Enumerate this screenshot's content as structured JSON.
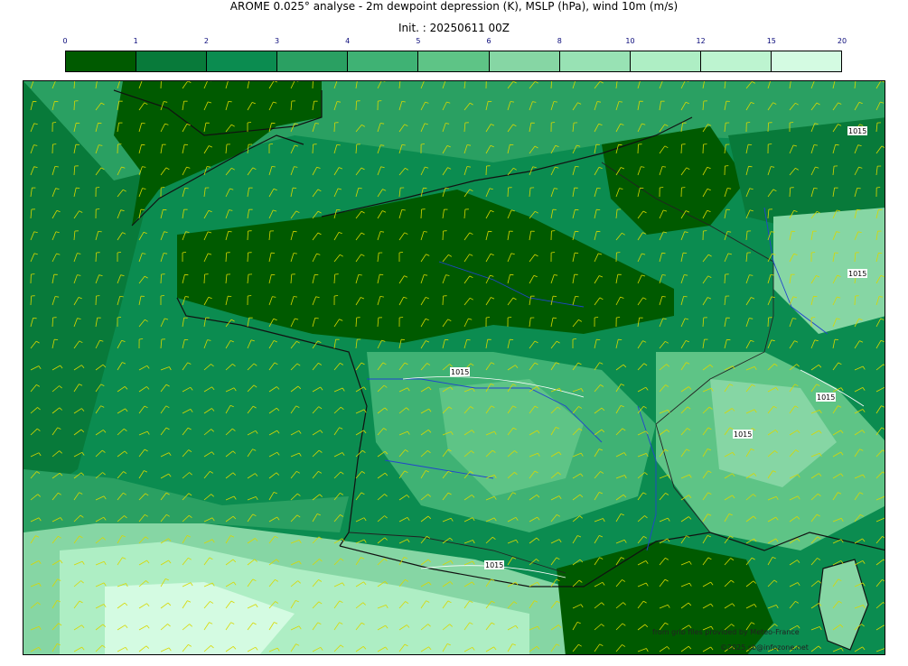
{
  "title": "AROME 0.025° analyse - 2m dewpoint depression (K), MSLP (hPa), wind 10m (m/s)",
  "subtitle": "Init. : 20250611 00Z",
  "colorbar": {
    "ticks": [
      "0",
      "1",
      "2",
      "3",
      "4",
      "5",
      "6",
      "8",
      "10",
      "12",
      "15",
      "20"
    ],
    "colors": [
      "#005a00",
      "#087a3a",
      "#0b8c50",
      "#2aa062",
      "#3fb274",
      "#5ec486",
      "#86d6a4",
      "#98e2b4",
      "#aeeec4",
      "#bdf4d0",
      "#d4fbe2"
    ]
  },
  "map": {
    "isobar_label": "1015",
    "wind_barb_color": "#d8d800",
    "coast_color": "#111111",
    "river_color": "#2244cc"
  },
  "credits": {
    "source": "from grib files provided by Meteo-France",
    "copyright": "©2025 sb@infozone.net"
  }
}
